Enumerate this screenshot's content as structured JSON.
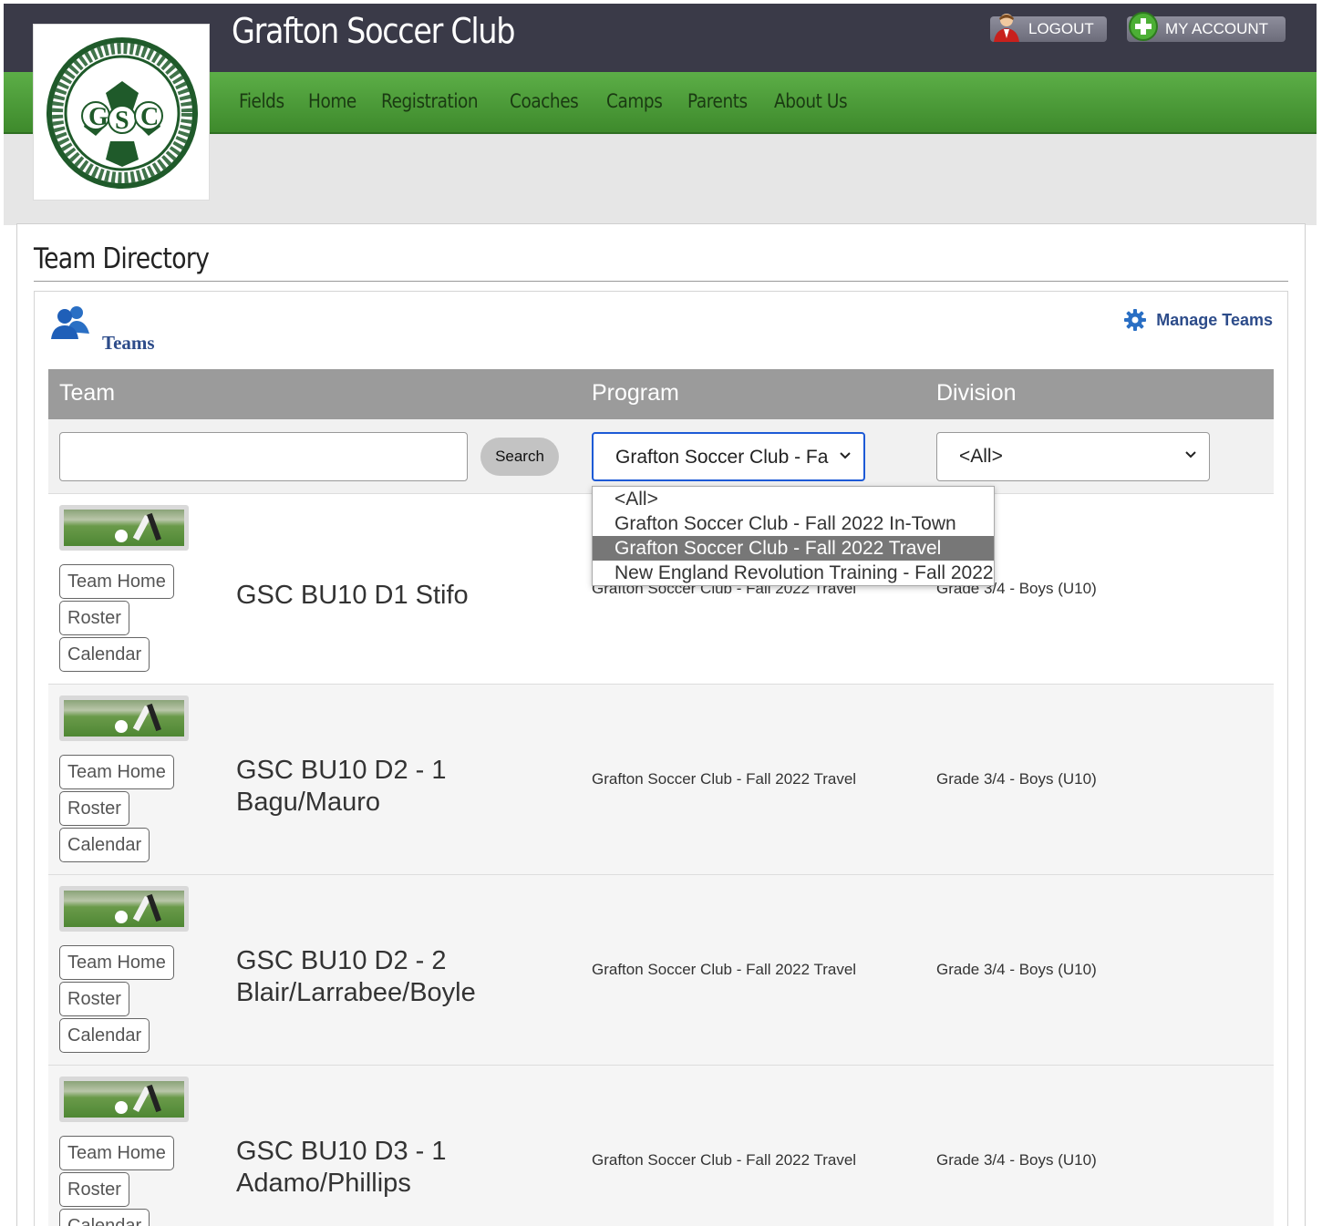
{
  "header": {
    "site_title": "Grafton Soccer Club",
    "logout_label": "LOGOUT",
    "account_label": "MY ACCOUNT",
    "logo_alt": "GSC"
  },
  "nav": {
    "items": [
      "Fields",
      "Home",
      "Registration",
      "Coaches",
      "Camps",
      "Parents",
      "About Us"
    ]
  },
  "page": {
    "title": "Team Directory",
    "section_label": "Teams",
    "manage_label": "Manage Teams"
  },
  "table": {
    "headers": {
      "team": "Team",
      "program": "Program",
      "division": "Division"
    },
    "search_label": "Search",
    "search_value": "",
    "program_selected": "Grafton Soccer Club - Fa",
    "division_selected": "<All>",
    "program_options": [
      "<All>",
      "Grafton Soccer Club - Fall 2022 In-Town",
      "Grafton Soccer Club - Fall 2022 Travel",
      "New England Revolution Training - Fall 2022"
    ],
    "program_options_selected_index": 2,
    "row_buttons": {
      "home": "Team Home",
      "roster": "Roster",
      "calendar": "Calendar"
    },
    "rows": [
      {
        "name": "GSC BU10 D1 Stifo",
        "program": "Grafton Soccer Club - Fall 2022 Travel",
        "division": "Grade 3/4 - Boys (U10)"
      },
      {
        "name": "GSC BU10 D2 - 1 Bagu/Mauro",
        "program": "Grafton Soccer Club - Fall 2022 Travel",
        "division": "Grade 3/4 - Boys (U10)"
      },
      {
        "name": "GSC BU10 D2 - 2 Blair/Larrabee/Boyle",
        "program": "Grafton Soccer Club - Fall 2022 Travel",
        "division": "Grade 3/4 - Boys (U10)"
      },
      {
        "name": "GSC BU10 D3 - 1 Adamo/Phillips",
        "program": "Grafton Soccer Club - Fall 2022 Travel",
        "division": "Grade 3/4 - Boys (U10)"
      }
    ]
  },
  "colors": {
    "header_bg": "#3a3a48",
    "nav_green": "#4f9e3a",
    "link_blue": "#2d4c8a",
    "focus_blue": "#1d5ad6"
  }
}
